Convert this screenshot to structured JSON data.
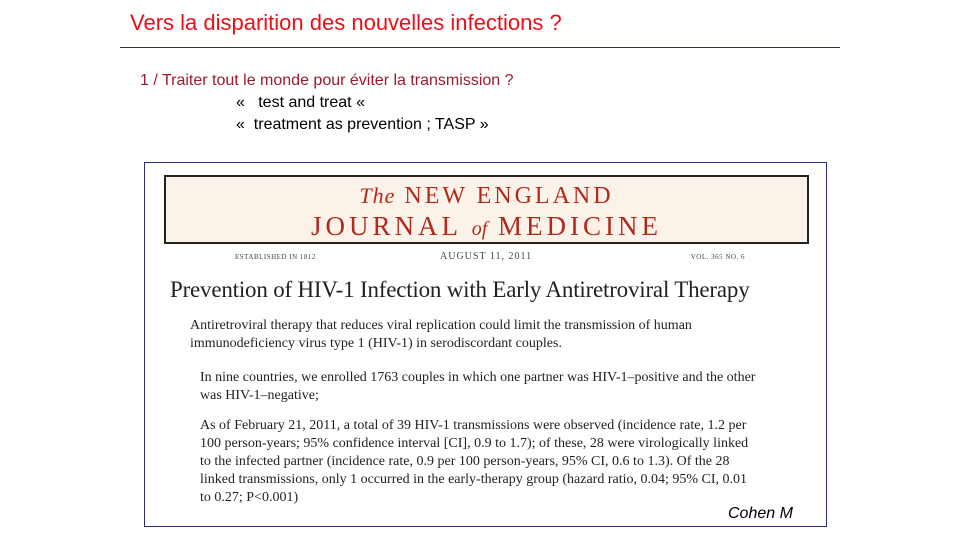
{
  "slide": {
    "title": "Vers la disparition des nouvelles infections ?",
    "point": "1 / Traiter tout le monde pour éviter la transmission ?",
    "sub_items": [
      "«   test and treat «",
      "«  treatment as prevention ; TASP »"
    ]
  },
  "journal": {
    "masthead_the": "The",
    "masthead_line1": "NEW ENGLAND",
    "masthead_journal": "JOURNAL",
    "masthead_of": "of",
    "masthead_medicine": "MEDICINE",
    "established": "ESTABLISHED IN 1812",
    "date": "AUGUST 11, 2011",
    "volume": "VOL. 365   NO. 6"
  },
  "article": {
    "title": "Prevention of HIV-1 Infection with Early Antiretroviral Therapy",
    "abstract": "Antiretroviral therapy that reduces viral replication could limit the transmission of human immunodeficiency virus type 1 (HIV-1) in serodiscordant couples.",
    "para1": "In nine countries, we enrolled 1763 couples in which one partner was HIV-1–positive and the other was HIV-1–negative;",
    "para2": "As of February 21, 2011, a total of 39 HIV-1 transmissions were observed (incidence rate, 1.2 per 100 person-years; 95% confidence interval [CI], 0.9 to 1.7); of these, 28 were virologically linked to the infected partner (incidence rate, 0.9 per 100 person-years, 95% CI, 0.6 to 1.3). Of the 28 linked transmissions, only 1 occurred in the early-therapy group (hazard ratio, 0.04; 95% CI, 0.01 to 0.27; P<0.001)",
    "credit": "Cohen M"
  }
}
